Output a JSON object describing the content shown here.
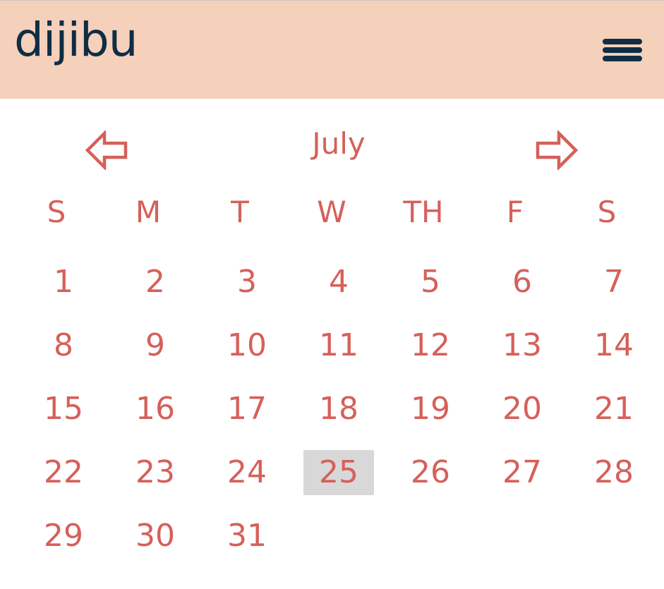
{
  "app": {
    "logo": "dijibu"
  },
  "header": {
    "menu_icon": "hamburger-menu-icon"
  },
  "calendar": {
    "month": "July",
    "prev_icon": "left-arrow-icon",
    "next_icon": "right-arrow-icon",
    "weekdays": [
      "S",
      "M",
      "T",
      "W",
      "TH",
      "F",
      "S"
    ],
    "days": [
      "1",
      "2",
      "3",
      "4",
      "5",
      "6",
      "7",
      "8",
      "9",
      "10",
      "11",
      "12",
      "13",
      "14",
      "15",
      "16",
      "17",
      "18",
      "19",
      "20",
      "21",
      "22",
      "23",
      "24",
      "25",
      "26",
      "27",
      "28",
      "29",
      "30",
      "31"
    ],
    "first_weekday_index": 0,
    "selected_day": "25"
  },
  "colors": {
    "header_bg": "#f5d0bb",
    "brand": "#0f2d44",
    "accent": "#d6605a",
    "selected_bg": "#d8d8d8"
  }
}
